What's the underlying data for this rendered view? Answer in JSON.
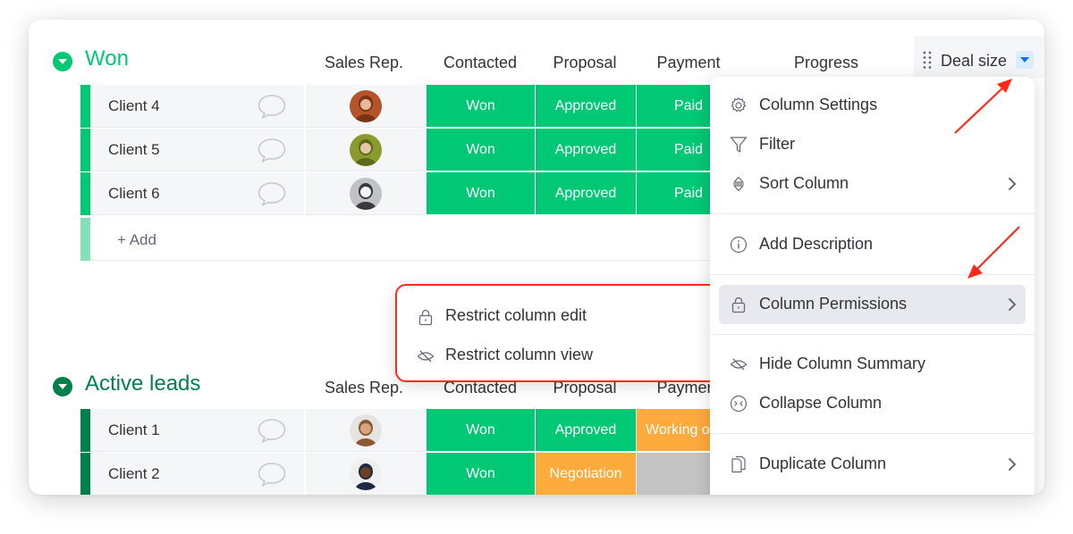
{
  "groups": [
    {
      "title": "Won",
      "color": "#00c875",
      "columns": [
        "Sales Rep.",
        "Contacted",
        "Proposal",
        "Payment",
        "Progress"
      ],
      "deal_size_column": "Deal size",
      "rows": [
        {
          "name": "Client 4",
          "avatar": "avatar-woman-red-hair",
          "contacted": "Won",
          "proposal": "Approved",
          "payment": "Paid"
        },
        {
          "name": "Client 5",
          "avatar": "avatar-man-smiling",
          "contacted": "Won",
          "proposal": "Approved",
          "payment": "Paid"
        },
        {
          "name": "Client 6",
          "avatar": "avatar-person-white-shirt",
          "contacted": "Won",
          "proposal": "Approved",
          "payment": "Paid"
        }
      ],
      "add_label": "+ Add"
    },
    {
      "title": "Active leads",
      "color": "#037f4c",
      "columns": [
        "Sales Rep.",
        "Contacted",
        "Proposal",
        "Payment"
      ],
      "rows": [
        {
          "name": "Client 1",
          "avatar": "avatar-woman-long-hair",
          "contacted": "Won",
          "proposal": "Approved",
          "payment": "Working on it"
        },
        {
          "name": "Client 2",
          "avatar": "avatar-man-glasses",
          "contacted": "Won",
          "proposal": "Negotiation",
          "payment": ""
        }
      ]
    }
  ],
  "status_colors": {
    "Won": "#00c875",
    "Approved": "#00c875",
    "Paid": "#00c875",
    "Negotiation": "#fdab3d",
    "Working on it": "#fdab3d",
    "empty": "#c4c4c4"
  },
  "column_menu": {
    "items": [
      {
        "label": "Column Settings",
        "icon": "gear-icon",
        "has_submenu": false
      },
      {
        "label": "Filter",
        "icon": "filter-icon",
        "has_submenu": false
      },
      {
        "label": "Sort Column",
        "icon": "sort-icon",
        "has_submenu": true
      },
      {
        "label": "Add Description",
        "icon": "info-icon",
        "has_submenu": false
      },
      {
        "label": "Column Permissions",
        "icon": "lock-icon",
        "has_submenu": true,
        "active": true
      },
      {
        "label": "Hide Column Summary",
        "icon": "eye-off-icon",
        "has_submenu": false
      },
      {
        "label": "Collapse Column",
        "icon": "collapse-icon",
        "has_submenu": false
      },
      {
        "label": "Duplicate Column",
        "icon": "duplicate-icon",
        "has_submenu": true
      }
    ]
  },
  "permissions_submenu": {
    "items": [
      {
        "label": "Restrict column edit",
        "icon": "lock-icon"
      },
      {
        "label": "Restrict column view",
        "icon": "eye-off-icon"
      }
    ]
  },
  "annotation_color": "#ff2a1a"
}
